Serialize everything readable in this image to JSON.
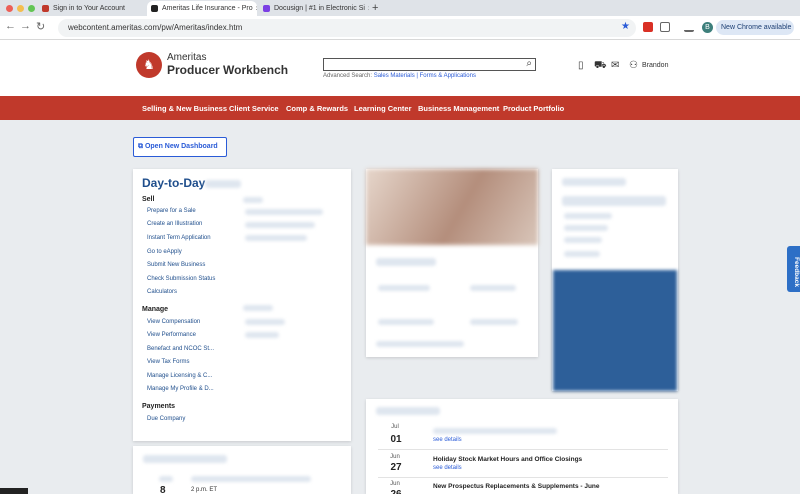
{
  "browser": {
    "tabs": [
      {
        "label": "Sign in to Your Account",
        "fav_color": "#c0392b"
      },
      {
        "label": "Ameritas Life Insurance - Pro",
        "fav_color": "#222222"
      },
      {
        "label": "Docusign | #1 in Electronic Si",
        "fav_color": "#7b3fe4"
      }
    ],
    "tab_close": "×",
    "new_tab": "+",
    "url": "webcontent.ameritas.com/pw/Ameritas/index.htm",
    "chrome_button": "New Chrome available",
    "avatar_letter": "B"
  },
  "header": {
    "brand_line1": "Ameritas",
    "brand_line2": "Producer Workbench",
    "search_placeholder": "",
    "advanced_search_prefix": "Advanced Search:",
    "advanced_search_link1": "Sales Materials",
    "advanced_search_sep": "|",
    "advanced_search_link2": "Forms & Applications",
    "user_name": "Brandon"
  },
  "nav": {
    "items": [
      "Selling & New Business",
      "Client Service",
      "Comp & Rewards",
      "Learning Center",
      "Business Management",
      "Product Portfolio"
    ]
  },
  "dashboard_button": "Open New Dashboard",
  "day_to_day": {
    "title": "Day-to-Day",
    "sections": [
      {
        "heading": "Sell",
        "links": [
          "Prepare for a Sale",
          "Create an Illustration",
          "Instant Term Application",
          "Go to eApply",
          "Submit New Business",
          "Check Submission Status",
          "Calculators"
        ]
      },
      {
        "heading": "Manage",
        "links": [
          "View Compensation",
          "View Performance",
          "Benefact and NCOC St...",
          "View Tax Forms",
          "Manage Licensing & C...",
          "Manage My Profile & D..."
        ]
      },
      {
        "heading": "Payments",
        "links": [
          "Due Company"
        ]
      }
    ]
  },
  "news": {
    "items": [
      {
        "month": "Jul",
        "day": "01",
        "title": "",
        "see": "see details"
      },
      {
        "month": "Jun",
        "day": "27",
        "title": "Holiday Stock Market Hours and Office Closings",
        "see": "see details"
      },
      {
        "month": "Jun",
        "day": "26",
        "title": "New Prospectus Replacements & Supplements - June",
        "see": ""
      }
    ]
  },
  "events": {
    "day": "8",
    "time": "2 p.m. ET"
  },
  "feedback_label": "Feedback"
}
